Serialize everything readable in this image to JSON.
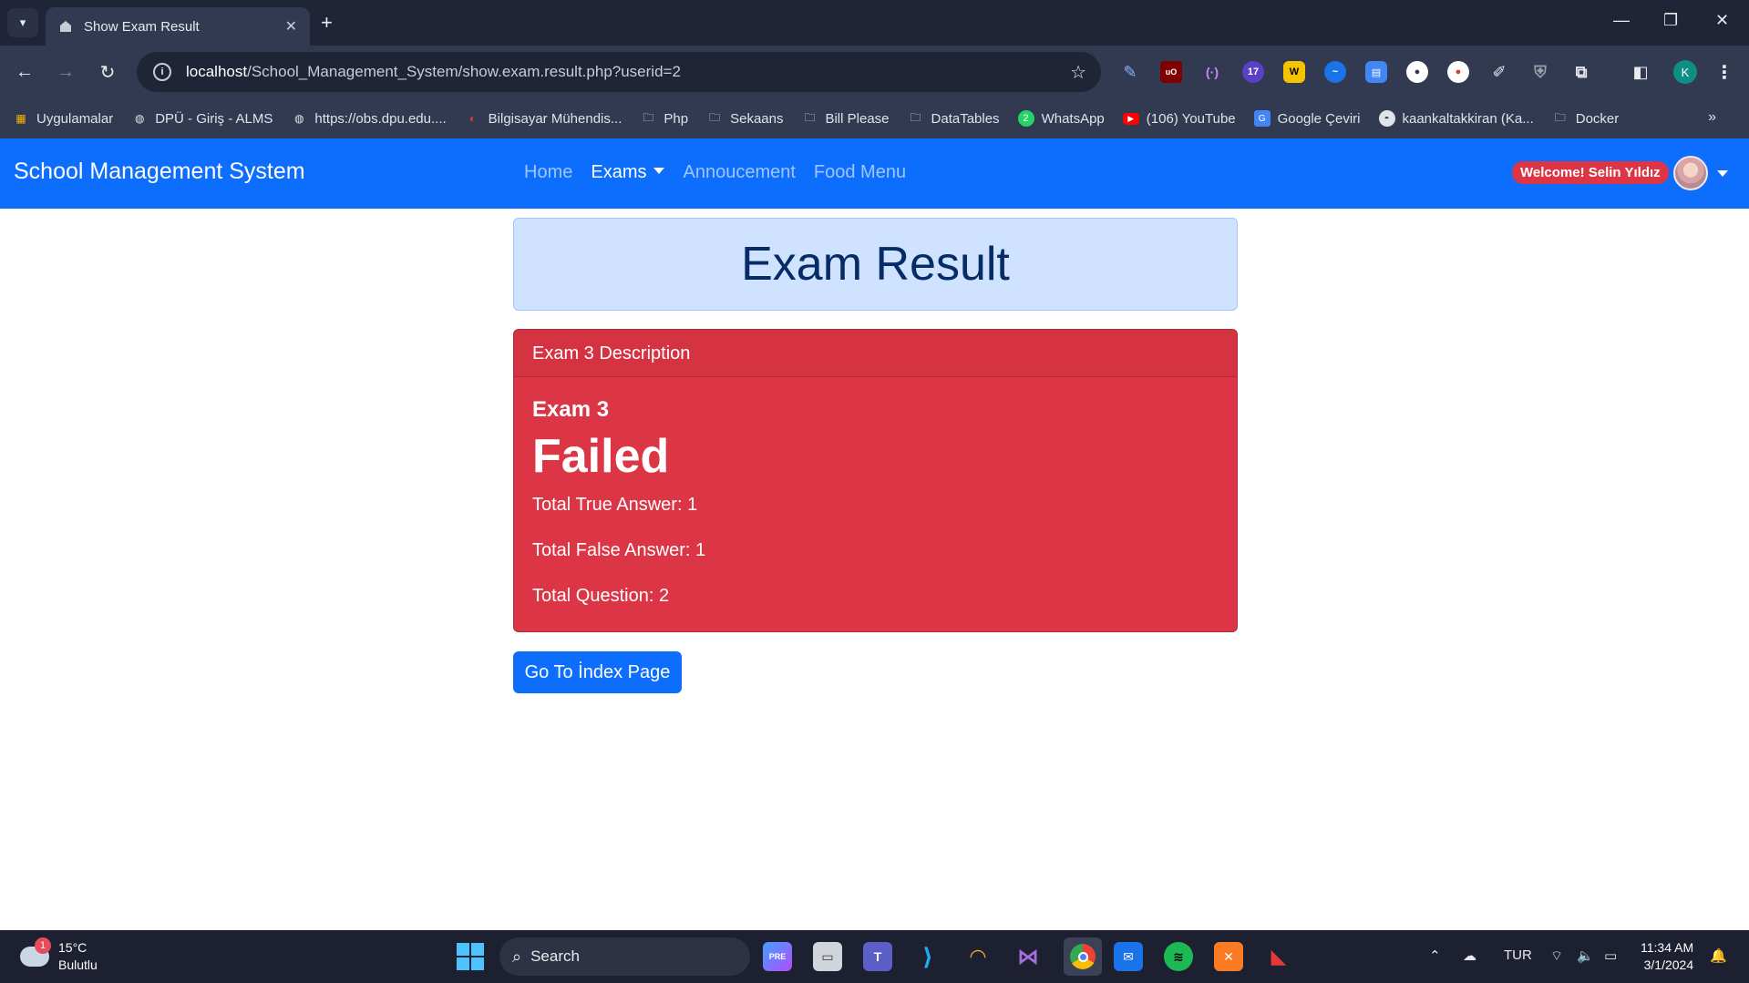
{
  "browser": {
    "tab_title": "Show Exam Result",
    "url_host": "localhost",
    "url_path": "/School_Management_System/show.exam.result.php?userid=2",
    "bookmarks": [
      {
        "label": "Uygulamalar",
        "icon": "apps-grid-icon"
      },
      {
        "label": "DPÜ - Giriş - ALMS",
        "icon": "globe-icon"
      },
      {
        "label": "https://obs.dpu.edu....",
        "icon": "globe-icon"
      },
      {
        "label": "Bilgisayar Mühendis...",
        "icon": "site-icon"
      },
      {
        "label": "Php",
        "icon": "folder-icon"
      },
      {
        "label": "Sekaans",
        "icon": "folder-icon"
      },
      {
        "label": "Bill Please",
        "icon": "folder-icon"
      },
      {
        "label": "DataTables",
        "icon": "folder-icon"
      },
      {
        "label": "WhatsApp",
        "icon": "whatsapp-icon"
      },
      {
        "label": "(106) YouTube",
        "icon": "youtube-icon"
      },
      {
        "label": "Google Çeviri",
        "icon": "google-translate-icon"
      },
      {
        "label": "kaankaltakkiran (Ka...",
        "icon": "github-icon"
      },
      {
        "label": "Docker",
        "icon": "folder-icon"
      }
    ],
    "extension_badge": "17",
    "profile_initial": "K"
  },
  "navbar": {
    "brand": "School Management System",
    "links": {
      "home": "Home",
      "exams": "Exams",
      "announcement": "Annoucement",
      "food_menu": "Food Menu"
    },
    "welcome": "Welcome! Selin Yıldız"
  },
  "page": {
    "title": "Exam Result",
    "card": {
      "header": "Exam 3 Description",
      "exam_name": "Exam 3",
      "status": "Failed",
      "total_true": "Total True Answer: 1",
      "total_false": "Total False Answer: 1",
      "total_question": "Total Question: 2"
    },
    "go_button": "Go To İndex Page"
  },
  "taskbar": {
    "weather_temp": "15°C",
    "weather_desc": "Bulutlu",
    "weather_badge": "1",
    "search_label": "Search",
    "language": "TUR",
    "time": "11:34 AM",
    "date": "3/1/2024"
  },
  "colors": {
    "navbar": "#0d6efd",
    "danger": "#dc3545",
    "title_bg": "#cfe2ff",
    "title_text": "#052c65"
  }
}
